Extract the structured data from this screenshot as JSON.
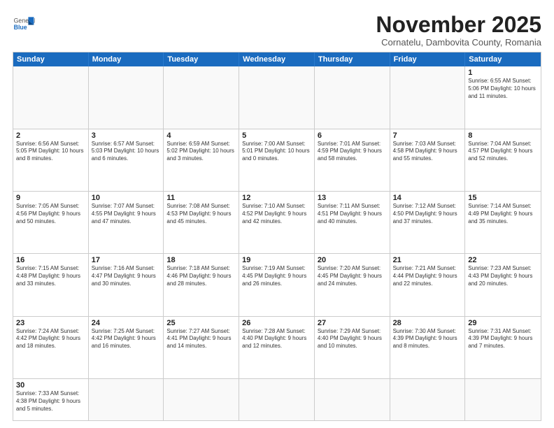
{
  "header": {
    "logo_general": "General",
    "logo_blue": "Blue",
    "month_title": "November 2025",
    "subtitle": "Cornatelu, Dambovita County, Romania"
  },
  "days_of_week": [
    "Sunday",
    "Monday",
    "Tuesday",
    "Wednesday",
    "Thursday",
    "Friday",
    "Saturday"
  ],
  "weeks": [
    [
      {
        "day": "",
        "info": ""
      },
      {
        "day": "",
        "info": ""
      },
      {
        "day": "",
        "info": ""
      },
      {
        "day": "",
        "info": ""
      },
      {
        "day": "",
        "info": ""
      },
      {
        "day": "",
        "info": ""
      },
      {
        "day": "1",
        "info": "Sunrise: 6:55 AM\nSunset: 5:06 PM\nDaylight: 10 hours and 11 minutes."
      }
    ],
    [
      {
        "day": "2",
        "info": "Sunrise: 6:56 AM\nSunset: 5:05 PM\nDaylight: 10 hours and 8 minutes."
      },
      {
        "day": "3",
        "info": "Sunrise: 6:57 AM\nSunset: 5:03 PM\nDaylight: 10 hours and 6 minutes."
      },
      {
        "day": "4",
        "info": "Sunrise: 6:59 AM\nSunset: 5:02 PM\nDaylight: 10 hours and 3 minutes."
      },
      {
        "day": "5",
        "info": "Sunrise: 7:00 AM\nSunset: 5:01 PM\nDaylight: 10 hours and 0 minutes."
      },
      {
        "day": "6",
        "info": "Sunrise: 7:01 AM\nSunset: 4:59 PM\nDaylight: 9 hours and 58 minutes."
      },
      {
        "day": "7",
        "info": "Sunrise: 7:03 AM\nSunset: 4:58 PM\nDaylight: 9 hours and 55 minutes."
      },
      {
        "day": "8",
        "info": "Sunrise: 7:04 AM\nSunset: 4:57 PM\nDaylight: 9 hours and 52 minutes."
      }
    ],
    [
      {
        "day": "9",
        "info": "Sunrise: 7:05 AM\nSunset: 4:56 PM\nDaylight: 9 hours and 50 minutes."
      },
      {
        "day": "10",
        "info": "Sunrise: 7:07 AM\nSunset: 4:55 PM\nDaylight: 9 hours and 47 minutes."
      },
      {
        "day": "11",
        "info": "Sunrise: 7:08 AM\nSunset: 4:53 PM\nDaylight: 9 hours and 45 minutes."
      },
      {
        "day": "12",
        "info": "Sunrise: 7:10 AM\nSunset: 4:52 PM\nDaylight: 9 hours and 42 minutes."
      },
      {
        "day": "13",
        "info": "Sunrise: 7:11 AM\nSunset: 4:51 PM\nDaylight: 9 hours and 40 minutes."
      },
      {
        "day": "14",
        "info": "Sunrise: 7:12 AM\nSunset: 4:50 PM\nDaylight: 9 hours and 37 minutes."
      },
      {
        "day": "15",
        "info": "Sunrise: 7:14 AM\nSunset: 4:49 PM\nDaylight: 9 hours and 35 minutes."
      }
    ],
    [
      {
        "day": "16",
        "info": "Sunrise: 7:15 AM\nSunset: 4:48 PM\nDaylight: 9 hours and 33 minutes."
      },
      {
        "day": "17",
        "info": "Sunrise: 7:16 AM\nSunset: 4:47 PM\nDaylight: 9 hours and 30 minutes."
      },
      {
        "day": "18",
        "info": "Sunrise: 7:18 AM\nSunset: 4:46 PM\nDaylight: 9 hours and 28 minutes."
      },
      {
        "day": "19",
        "info": "Sunrise: 7:19 AM\nSunset: 4:45 PM\nDaylight: 9 hours and 26 minutes."
      },
      {
        "day": "20",
        "info": "Sunrise: 7:20 AM\nSunset: 4:45 PM\nDaylight: 9 hours and 24 minutes."
      },
      {
        "day": "21",
        "info": "Sunrise: 7:21 AM\nSunset: 4:44 PM\nDaylight: 9 hours and 22 minutes."
      },
      {
        "day": "22",
        "info": "Sunrise: 7:23 AM\nSunset: 4:43 PM\nDaylight: 9 hours and 20 minutes."
      }
    ],
    [
      {
        "day": "23",
        "info": "Sunrise: 7:24 AM\nSunset: 4:42 PM\nDaylight: 9 hours and 18 minutes."
      },
      {
        "day": "24",
        "info": "Sunrise: 7:25 AM\nSunset: 4:42 PM\nDaylight: 9 hours and 16 minutes."
      },
      {
        "day": "25",
        "info": "Sunrise: 7:27 AM\nSunset: 4:41 PM\nDaylight: 9 hours and 14 minutes."
      },
      {
        "day": "26",
        "info": "Sunrise: 7:28 AM\nSunset: 4:40 PM\nDaylight: 9 hours and 12 minutes."
      },
      {
        "day": "27",
        "info": "Sunrise: 7:29 AM\nSunset: 4:40 PM\nDaylight: 9 hours and 10 minutes."
      },
      {
        "day": "28",
        "info": "Sunrise: 7:30 AM\nSunset: 4:39 PM\nDaylight: 9 hours and 8 minutes."
      },
      {
        "day": "29",
        "info": "Sunrise: 7:31 AM\nSunset: 4:39 PM\nDaylight: 9 hours and 7 minutes."
      }
    ],
    [
      {
        "day": "30",
        "info": "Sunrise: 7:33 AM\nSunset: 4:38 PM\nDaylight: 9 hours and 5 minutes."
      },
      {
        "day": "",
        "info": ""
      },
      {
        "day": "",
        "info": ""
      },
      {
        "day": "",
        "info": ""
      },
      {
        "day": "",
        "info": ""
      },
      {
        "day": "",
        "info": ""
      },
      {
        "day": "",
        "info": ""
      }
    ]
  ]
}
